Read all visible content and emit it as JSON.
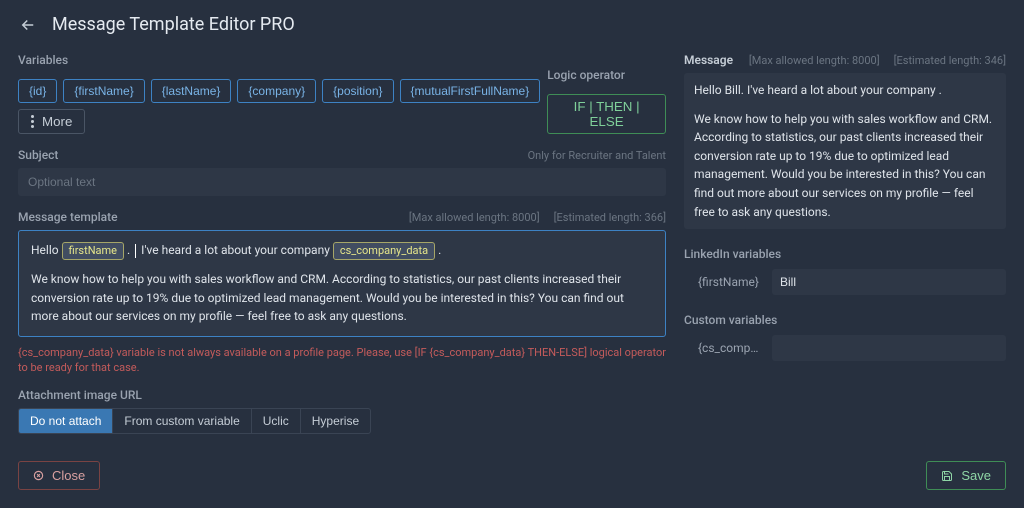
{
  "header": {
    "title": "Message Template Editor PRO"
  },
  "variables": {
    "label": "Variables",
    "chips": [
      "{id}",
      "{firstName}",
      "{lastName}",
      "{company}",
      "{position}",
      "{mutualFirstFullName}"
    ],
    "more_label": "More"
  },
  "logic": {
    "label": "Logic operator",
    "button": "IF | THEN | ELSE"
  },
  "subject": {
    "label": "Subject",
    "hint": "Only for Recruiter and Talent",
    "placeholder": "Optional text"
  },
  "template": {
    "label": "Message template",
    "max": "[Max allowed length: 8000]",
    "est": "[Estimated length: 366]",
    "line1_a": "Hello",
    "var1": "firstName",
    "line1_b": ".",
    "line1_c": "I've heard a lot about your company",
    "var2": "cs_company_data",
    "line1_d": ".",
    "body": "We know how to help you with sales workflow and CRM. According to statistics, our past clients increased their conversion rate up to 19% due to optimized lead management. Would you be interested in this? You can find out more about our services on my profile — feel free to ask any questions.",
    "warning": "{cs_company_data} variable is not always available on a profile page. Please, use [IF {cs_company_data} THEN-ELSE] logical operator to be ready for that case."
  },
  "attachment": {
    "label": "Attachment image URL",
    "options": [
      "Do not attach",
      "From custom variable",
      "Uclic",
      "Hyperise"
    ],
    "active_index": 0
  },
  "footer": {
    "close": "Close",
    "save": "Save"
  },
  "preview": {
    "label": "Message",
    "max": "[Max allowed length: 8000]",
    "est": "[Estimated length: 346]",
    "line1": "Hello  Bill.  I've heard a lot about your company .",
    "body": "We know how to help you with sales workflow and CRM. According to statistics, our past clients increased their conversion rate up to 19% due to optimized lead management. Would you be interested in this? You can find out more about our services on my profile — feel free to ask any questions."
  },
  "linkedin": {
    "label": "LinkedIn variables",
    "rows": [
      {
        "name": "{firstName}",
        "value": "Bill"
      }
    ]
  },
  "custom": {
    "label": "Custom variables",
    "rows": [
      {
        "name": "{cs_company_...",
        "value": ""
      }
    ]
  }
}
